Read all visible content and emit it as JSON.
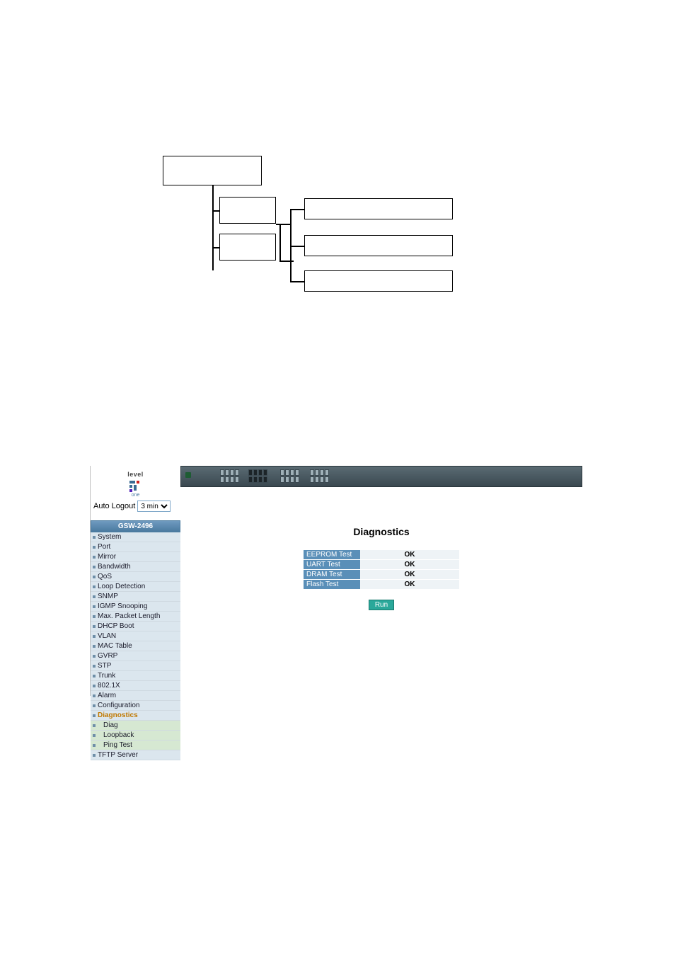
{
  "logo": {
    "brand_top": "level",
    "brand_bottom": "one"
  },
  "auto_logout": {
    "label": "Auto Logout",
    "value": "3 min"
  },
  "nav": {
    "header": "GSW-2496",
    "items": [
      {
        "label": "System"
      },
      {
        "label": "Port"
      },
      {
        "label": "Mirror"
      },
      {
        "label": "Bandwidth"
      },
      {
        "label": "QoS"
      },
      {
        "label": "Loop Detection"
      },
      {
        "label": "SNMP"
      },
      {
        "label": "IGMP Snooping"
      },
      {
        "label": "Max. Packet Length"
      },
      {
        "label": "DHCP Boot"
      },
      {
        "label": "VLAN"
      },
      {
        "label": "MAC Table"
      },
      {
        "label": "GVRP"
      },
      {
        "label": "STP"
      },
      {
        "label": "Trunk"
      },
      {
        "label": "802.1X"
      },
      {
        "label": "Alarm"
      },
      {
        "label": "Configuration"
      },
      {
        "label": "Diagnostics",
        "active": true
      },
      {
        "label": "Diag",
        "sub": true
      },
      {
        "label": "Loopback",
        "sub": true
      },
      {
        "label": "Ping Test",
        "sub": true
      },
      {
        "label": "TFTP Server"
      }
    ]
  },
  "diagnostics": {
    "title": "Diagnostics",
    "rows": [
      {
        "label": "EEPROM Test",
        "value": "OK"
      },
      {
        "label": "UART Test",
        "value": "OK"
      },
      {
        "label": "DRAM Test",
        "value": "OK"
      },
      {
        "label": "Flash Test",
        "value": "OK"
      }
    ],
    "run_label": "Run"
  }
}
